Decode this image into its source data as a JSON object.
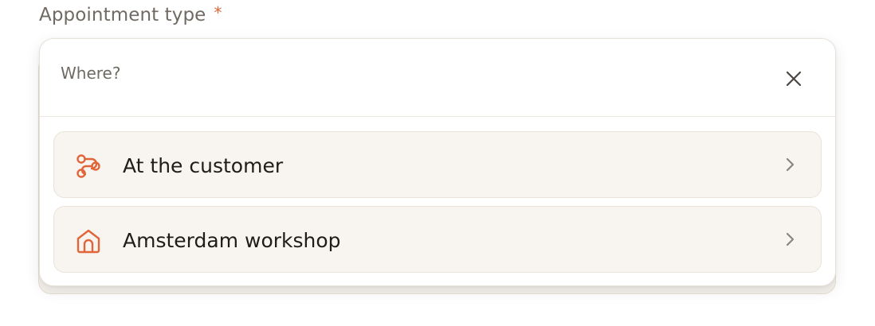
{
  "field": {
    "label": "Appointment type",
    "required_mark": "*"
  },
  "popup": {
    "title": "Where?",
    "close_icon": "close-icon",
    "options": [
      {
        "label": "At the customer",
        "icon": "route-icon",
        "chevron": "chevron-right-icon"
      },
      {
        "label": "Amsterdam workshop",
        "icon": "home-icon",
        "chevron": "chevron-right-icon"
      }
    ]
  },
  "colors": {
    "accent": "#e0663a",
    "label_text": "#6f6a63",
    "option_bg": "#f8f5f0",
    "option_text": "#1f1d1a"
  }
}
